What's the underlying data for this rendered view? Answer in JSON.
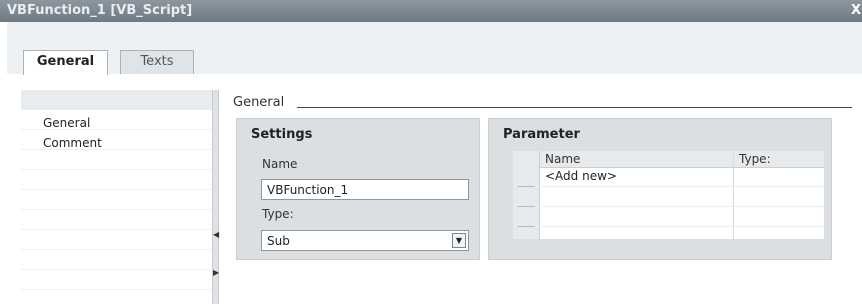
{
  "window": {
    "title": "VBFunction_1 [VB_Script]",
    "close_glyph": "X"
  },
  "tabs": [
    {
      "label": "General",
      "active": true
    },
    {
      "label": "Texts",
      "active": false
    }
  ],
  "nav": {
    "items": [
      {
        "label": "General"
      },
      {
        "label": "Comment"
      }
    ]
  },
  "section": {
    "title": "General"
  },
  "settings": {
    "title": "Settings",
    "name_label": "Name",
    "name_value": "VBFunction_1",
    "type_label": "Type:",
    "type_value": "Sub",
    "dropdown_glyph": "▼"
  },
  "parameter": {
    "title": "Parameter",
    "columns": [
      "Name",
      "Type:"
    ],
    "add_new": "<Add new>"
  },
  "colors": {
    "titlebar": "#7b858d",
    "group_background": "#dcdfe2",
    "tabstrip_background": "#eef1f3"
  },
  "icons": [
    "close-icon",
    "chevron-left-icon",
    "chevron-right-icon",
    "dropdown-arrow-icon"
  ]
}
